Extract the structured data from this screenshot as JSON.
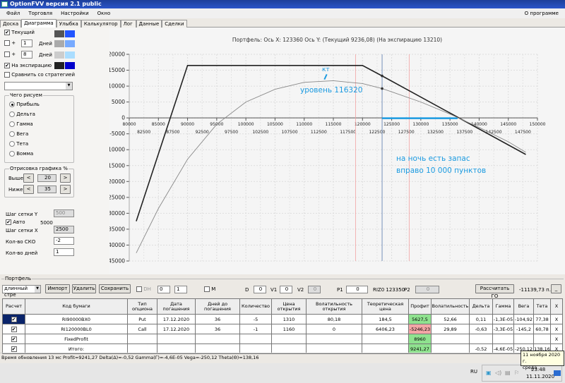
{
  "window": {
    "title": "OptionFVV версия 2.1 public"
  },
  "menu": {
    "items": [
      "Файл",
      "Торговля",
      "Настройки",
      "Окно"
    ],
    "about": "О программе"
  },
  "tabs": [
    "Доска",
    "Диаграмма",
    "Улыбка",
    "Калькулятор",
    "Лог",
    "Данные",
    "Сделки"
  ],
  "active_tab": "Диаграмма",
  "left": {
    "current": {
      "label": "Текущий",
      "checked": true,
      "colors": [
        "#555555",
        "#2255ff"
      ]
    },
    "plus1": {
      "plus": "+",
      "value": "1",
      "unit": "Дней",
      "checked": false,
      "colors": [
        "#aaaaaa",
        "#77aaff"
      ]
    },
    "plus8": {
      "plus": "+",
      "value": "8",
      "unit": "Дней",
      "checked": false,
      "colors": [
        "#cccccc",
        "#aaddff"
      ]
    },
    "expiration": {
      "label": "На экспирацию",
      "checked": true,
      "colors": [
        "#222222",
        "#0000cc"
      ]
    },
    "compare": {
      "label": "Сравнить со стратегией",
      "checked": false
    },
    "draw_group": {
      "title": "Чего рисуем",
      "options": [
        "Прибыль",
        "Дельта",
        "Гамма",
        "Вега",
        "Тета",
        "Вомма"
      ],
      "selected": "Прибыль"
    },
    "render_group": {
      "title": "Отрисовка графика %",
      "above_label": "Выше",
      "above": "20",
      "below_label": "Ниже",
      "below": "35",
      "prev": "<",
      "next": ">"
    },
    "grid_y_label": "Шаг сетки Y",
    "grid_y": "500",
    "auto_label": "Авто",
    "auto_checked": true,
    "auto_value": "5000",
    "grid_x_label": "Шаг сетки X",
    "grid_x": "2500",
    "sko_label": "Кол-во СКО",
    "sko": "-2",
    "days_label": "Кол-во дней",
    "days": "1"
  },
  "chart": {
    "header": "Портфель: Ось X: 123360 Ось Y:  (Текущий 9236,08)  (На экспирацию 13210)",
    "annotations": {
      "kt": "кт",
      "level": "уровень 116320",
      "night1": "на ночь есть запас",
      "night2": "вправо  10 000 пунктов"
    },
    "annotation_color": "#1a9ae0"
  },
  "chart_data": {
    "type": "line",
    "xlim": [
      80000,
      150000
    ],
    "ylim": [
      -45000,
      20000
    ],
    "grid": true,
    "x_ticks_top": [
      80000,
      85000,
      90000,
      95000,
      100000,
      105000,
      110000,
      115000,
      120000,
      125000,
      130000,
      135000,
      140000,
      145000,
      150000
    ],
    "x_ticks_bottom": [
      82500,
      87500,
      92500,
      97500,
      102500,
      107500,
      112500,
      117500,
      122500,
      127500,
      132500,
      137500,
      142500,
      147500
    ],
    "y_ticks": [
      20000,
      15000,
      10000,
      5000,
      0,
      -5000,
      -10000,
      -15000,
      -20000,
      -25000,
      -30000,
      -35000,
      -40000,
      -45000
    ],
    "series": [
      {
        "color": "#222222",
        "points": [
          [
            81200,
            -32500
          ],
          [
            90000,
            16500
          ],
          [
            120000,
            16500
          ],
          [
            123360,
            13210
          ],
          [
            148000,
            -11500
          ]
        ]
      },
      {
        "color": "#888888",
        "points": [
          [
            81200,
            -42500
          ],
          [
            85000,
            -28500
          ],
          [
            90000,
            -13000
          ],
          [
            95000,
            -2000
          ],
          [
            100000,
            5000
          ],
          [
            105000,
            9000
          ],
          [
            110000,
            11200
          ],
          [
            115000,
            11700
          ],
          [
            120000,
            10800
          ],
          [
            123360,
            9236
          ],
          [
            125000,
            8200
          ],
          [
            130000,
            5000
          ],
          [
            135000,
            1200
          ],
          [
            140000,
            -3000
          ],
          [
            145000,
            -7500
          ],
          [
            148000,
            -10800
          ]
        ]
      }
    ],
    "markers": [
      [
        123360,
        13210
      ],
      [
        123360,
        9236
      ]
    ],
    "vlines": [
      {
        "x": 118800,
        "color": "#f0a0a0"
      },
      {
        "x": 128000,
        "color": "#f0a0a0"
      },
      {
        "x": 123360,
        "color": "#5577aa"
      }
    ],
    "range_bar": {
      "from": 123360,
      "to": 136300,
      "color": "#1a9ae0"
    }
  },
  "portfolio": {
    "title": "Портфель",
    "preset": "длинный стре",
    "import": "Импорт",
    "delete": "Удалить",
    "save": "Сохранить",
    "dh": "DH",
    "dh_a": "0",
    "dh_b": "1",
    "m": "M",
    "d_label": "D",
    "d": "0",
    "v1_label": "V1",
    "v1": "0",
    "v2_label": "V2",
    "v2": "0",
    "p1_label": "P1",
    "p1": "0",
    "riz": "RIZ0 123350",
    "p2_label": "P2",
    "p2": "0",
    "calc_go": "Рассчитать ГО",
    "go_value": "-11139,73 п.",
    "min": "_",
    "columns": [
      "Расчет",
      "Код бумаги",
      "Тип опциона",
      "Дата погашения",
      "Дней до погашения",
      "Количество",
      "Цена открытия",
      "Волатильность открытия",
      "Теоретическая цена",
      "Профит",
      "Волатильность",
      "Дельта",
      "Гамма",
      "Вега",
      "Тета",
      "X"
    ],
    "rows": [
      [
        "✔",
        "RI90000BX0",
        "Put",
        "17.12.2020",
        "36",
        "-5",
        "1310",
        "80,18",
        "184,5",
        "5627,5",
        "52,66",
        "0,11",
        "-1,3E-05",
        "-104,92",
        "77,38",
        "X"
      ],
      [
        "✔",
        "RI120000BL0",
        "Call",
        "17.12.2020",
        "36",
        "-1",
        "1160",
        "0",
        "6406,23",
        "-5246,23",
        "29,89",
        "-0,63",
        "-3,3E-05",
        "-145,2",
        "60,78",
        "X"
      ],
      [
        "✔",
        "FixedProfit",
        "",
        "",
        "",
        "",
        "",
        "",
        "",
        "8960",
        "",
        "",
        "",
        "",
        "",
        "X"
      ],
      [
        "✔",
        "Итого:",
        "",
        "",
        "",
        "",
        "",
        "",
        "",
        "9241,27",
        "",
        "-0,52",
        "-4,6E-05",
        "-250,12",
        "138,16",
        "X"
      ]
    ]
  },
  "status": "Время обновления 13 мс  Profit=9241,27 Delta(Δ)=-0,52 Gamma(Γ)=-4,6E-05 Vega=-250,12 Theta(Θ)=138,16",
  "tooltip": {
    "line1": "11 ноября 2020 г.",
    "line2": "среда"
  },
  "taskbar": {
    "lang": "RU",
    "time": "23:48",
    "date": "11.11.2020"
  }
}
